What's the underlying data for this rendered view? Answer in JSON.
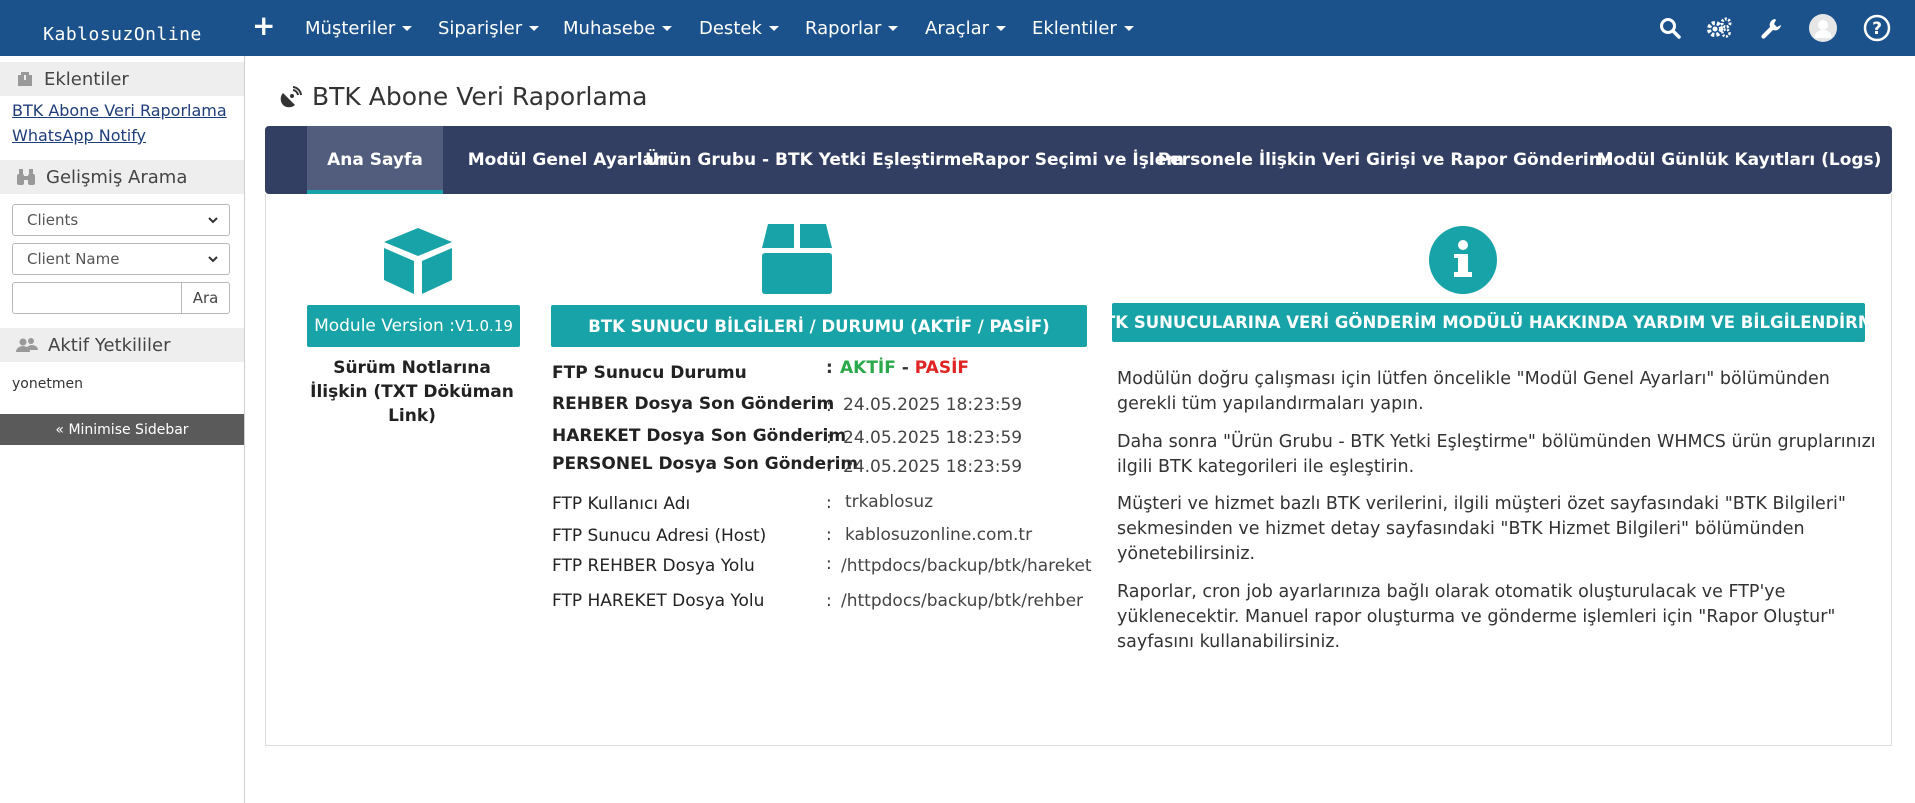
{
  "brand": "KablosuzOnline",
  "nav": {
    "add": "+",
    "menus": [
      "Müşteriler",
      "Siparişler",
      "Muhasebe",
      "Destek",
      "Raporlar",
      "Araçlar",
      "Eklentiler"
    ]
  },
  "sidebar": {
    "addons_title": "Eklentiler",
    "addons": [
      "BTK Abone Veri Raporlama",
      "WhatsApp Notify"
    ],
    "search_title": "Gelişmiş Arama",
    "search_type": "Clients",
    "search_field": "Client Name",
    "search_value": "",
    "search_button": "Ara",
    "admins_title": "Aktif Yetkililer",
    "admin_user": "yonetmen",
    "minimise": "« Minimise Sidebar"
  },
  "page": {
    "title": "BTK Abone Veri Raporlama"
  },
  "tabs": [
    "Ana Sayfa",
    "Modül Genel Ayarları",
    "Ürün Grubu - BTK Yetki Eşleştirme",
    "Rapor Seçimi ve İşlem",
    "Personele İlişkin Veri Girişi ve Rapor Gönderimi",
    "Modül Günlük Kayıtları (Logs)"
  ],
  "module": {
    "version_label": "Module Version :",
    "version": "V1.0.19",
    "release_notes": "Sürüm Notlarına İlişkin (TXT Döküman Link)"
  },
  "server": {
    "heading": "BTK SUNUCU BİLGİLERİ / DURUMU (AKTİF / PASİF)",
    "status_label": "FTP Sunucu Durumu",
    "status_active": "AKTİF",
    "status_sep": "-",
    "status_passive": "PASİF",
    "rows": [
      {
        "label": "REHBER Dosya Son Gönderim",
        "value": "24.05.2025 18:23:59"
      },
      {
        "label": "HAREKET Dosya Son Gönderim",
        "value": "24.05.2025 18:23:59"
      },
      {
        "label": "PERSONEL Dosya Son Gönderim",
        "value": "24.05.2025 18:23:59"
      },
      {
        "label": "FTP Kullanıcı Adı",
        "value": "trkablosuz"
      },
      {
        "label": "FTP Sunucu Adresi (Host)",
        "value": "kablosuzonline.com.tr"
      },
      {
        "label": "FTP REHBER Dosya Yolu",
        "value": "/httpdocs/backup/btk/hareket"
      },
      {
        "label": "FTP HAREKET Dosya Yolu",
        "value": "/httpdocs/backup/btk/rehber"
      }
    ]
  },
  "help": {
    "heading": "BTK SUNUCULARINA VERİ GÖNDERİM MODÜLÜ HAKKINDA YARDIM VE BİLGİLENDİRME",
    "paragraphs": [
      "Modülün doğru çalışması için lütfen öncelikle \"Modül Genel Ayarları\" bölümünden gerekli tüm yapılandırmaları yapın.",
      "Daha sonra \"Ürün Grubu - BTK Yetki Eşleştirme\" bölümünden WHMCS ürün gruplarınızı ilgili BTK kategorileri ile eşleştirin.",
      "Müşteri ve hizmet bazlı BTK verilerini, ilgili müşteri özet sayfasındaki \"BTK Bilgileri\" sekmesinden ve hizmet detay sayfasındaki \"BTK Hizmet Bilgileri\" bölümünden yönetebilirsiniz.",
      "Raporlar, cron job ayarlarınıza bağlı olarak otomatik oluşturulacak ve FTP'ye yüklenecektir. Manuel rapor oluşturma ve gönderme işlemleri için \"Rapor Oluştur\" sayfasını kullanabilirsiniz."
    ]
  },
  "colors": {
    "topbar": "#1c528c",
    "tabbar": "#333f62",
    "teal": "#17a3a7",
    "active": "#2aa84a",
    "passive": "#e02424"
  }
}
